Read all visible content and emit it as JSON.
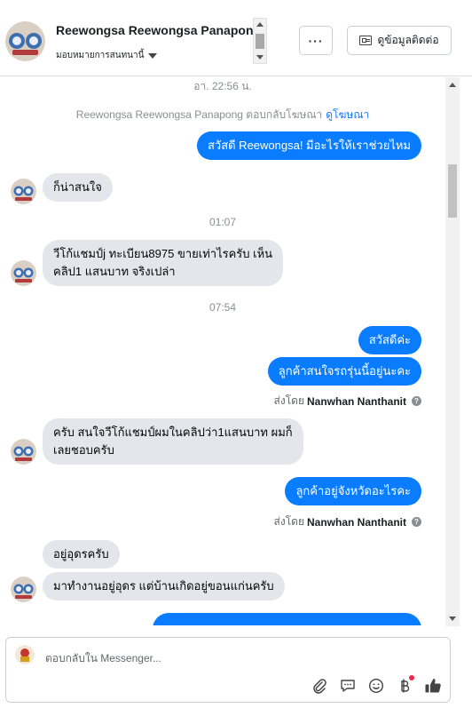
{
  "header": {
    "contact_name": "Reewongsa Reewongsa Panapong",
    "assign_label": "มอบหมายการสนทนานี้",
    "more_label": "···",
    "contact_info_label": "ดูข้อมูลติดต่อ"
  },
  "chat": {
    "timestamp_1": "อา. 22:56 น.",
    "ad_notice": "Reewongsa Reewongsa Panapong ตอบกลับโฆษณา",
    "ad_link": "ดูโฆษณา",
    "msg_1": "สวัสดี Reewongsa! มีอะไรให้เราช่วยไหม",
    "msg_2": "ก็น่าสนใจ",
    "timestamp_2": "01:07",
    "msg_3_line1": "วีโก้แชมป์j  ทะเบียน8975  ขายเท่าไรครับ เห็น",
    "msg_3_line2": "คลิป1 แสนบาท  จริงเปล่า",
    "timestamp_3": "07:54",
    "msg_4": "สวัสดีค่ะ",
    "msg_5": "ลูกค้าสนใจรถรุ่นนี้อยู่นะคะ",
    "sent_by_label": "ส่งโดย",
    "sender_name": "Nanwhan Nanthanit",
    "msg_6_line1": "ครับ สนใจวีโก้แชมป์ผมในคลิปว่า1แสนบาท ผมก็",
    "msg_6_line2": "เลยชอบครับ",
    "msg_7": "ลูกค้าอยู่จังหวัดอะไรคะ",
    "sent_by_label_2": "ส่งโดย",
    "sender_name_2": "Nanwhan Nanthanit",
    "msg_8": "อยู่อุดรครับ",
    "msg_9": "มาทำงานอยู่อุดร แต่บ้านเกิดอยู่ขอนแก่นครับ"
  },
  "composer": {
    "placeholder": "ตอบกลับใน Messenger...",
    "icons": [
      "paperclip-icon",
      "comment-icon",
      "emoji-icon",
      "baht-icon",
      "thumbs-up-icon"
    ]
  },
  "colors": {
    "outgoing_bubble": "#0a7cff",
    "incoming_bubble": "#e4e6eb",
    "link": "#1877f2",
    "notification_dot": "#f02849"
  }
}
